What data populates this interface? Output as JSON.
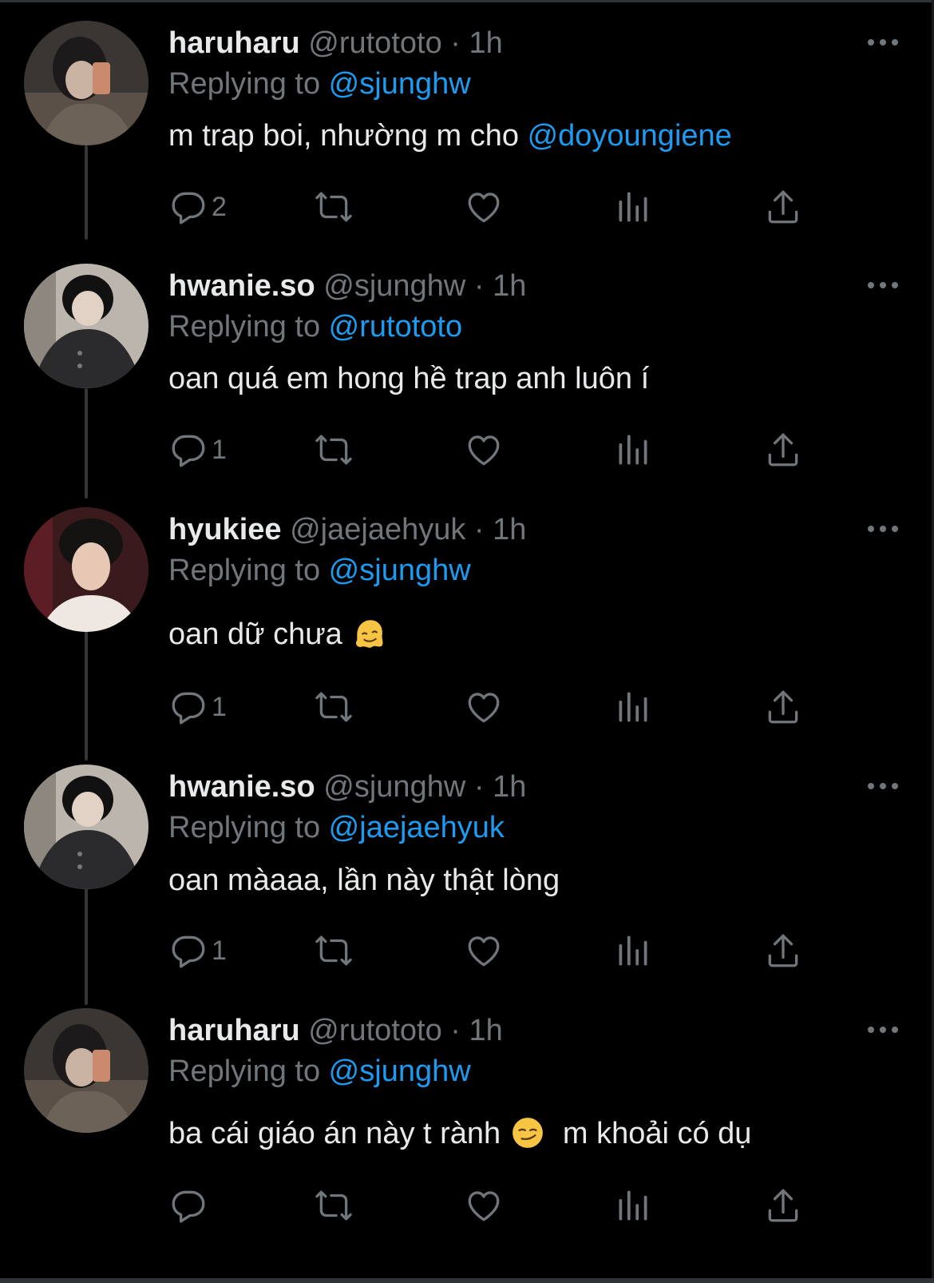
{
  "colors": {
    "background": "#000000",
    "text": "#e7e9ea",
    "muted": "#71767b",
    "accent": "#1d9bf0"
  },
  "tweets": [
    {
      "name": "haruharu",
      "handle": "@rutototo",
      "dot": "·",
      "time": "1h",
      "reply_prefix": "Replying to ",
      "reply_to": "@sjunghw",
      "body_parts": [
        "m trap boi, nhường m cho ",
        "@doyoungiene"
      ],
      "reply_count": "2",
      "icons": [
        "reply-icon",
        "retweet-icon",
        "like-icon",
        "views-icon",
        "share-icon",
        "more-icon"
      ]
    },
    {
      "name": "hwanie.so",
      "handle": "@sjunghw",
      "dot": "·",
      "time": "1h",
      "reply_prefix": "Replying to ",
      "reply_to": "@rutototo",
      "body_parts": [
        "oan quá em hong hề trap anh luôn í"
      ],
      "reply_count": "1"
    },
    {
      "name": "hyukiee",
      "handle": "@jaejaehyuk",
      "dot": "·",
      "time": "1h",
      "reply_prefix": "Replying to ",
      "reply_to": "@sjunghw",
      "body_parts": [
        "oan dữ chưa "
      ],
      "emoji": "melting-face-emoji",
      "reply_count": "1"
    },
    {
      "name": "hwanie.so",
      "handle": "@sjunghw",
      "dot": "·",
      "time": "1h",
      "reply_prefix": "Replying to ",
      "reply_to": "@jaejaehyuk",
      "body_parts": [
        "oan màaaa, lần này thật lòng"
      ],
      "reply_count": "1"
    },
    {
      "name": "haruharu",
      "handle": "@rutototo",
      "dot": "·",
      "time": "1h",
      "reply_prefix": "Replying to ",
      "reply_to": "@sjunghw",
      "body_parts": [
        "ba cái giáo án này t rành ",
        "  m khoải có dụ"
      ],
      "emoji": "smirking-face-emoji",
      "reply_count": ""
    }
  ]
}
